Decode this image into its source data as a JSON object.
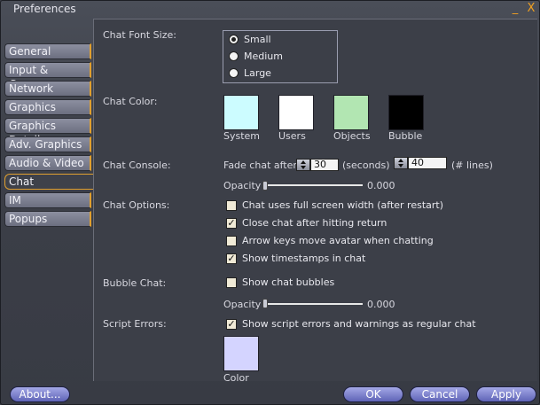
{
  "window": {
    "title": "Preferences",
    "minimize_icon": "minimize-icon",
    "close_icon": "close-icon",
    "minimize_glyph": "_",
    "close_glyph": "X"
  },
  "tabs": [
    {
      "label": "General"
    },
    {
      "label": "Input & Camera"
    },
    {
      "label": "Network"
    },
    {
      "label": "Graphics"
    },
    {
      "label": "Graphics Detail"
    },
    {
      "label": "Adv. Graphics"
    },
    {
      "label": "Audio & Video"
    },
    {
      "label": "Chat"
    },
    {
      "label": "IM"
    },
    {
      "label": "Popups"
    }
  ],
  "selected_tab": "Chat",
  "chat": {
    "font_size_label": "Chat Font Size:",
    "font_sizes": [
      "Small",
      "Medium",
      "Large"
    ],
    "font_size_selected": "Small",
    "color_label": "Chat Color:",
    "colors": [
      {
        "label": "System",
        "color": "#ccfcff"
      },
      {
        "label": "Users",
        "color": "#ffffff"
      },
      {
        "label": "Objects",
        "color": "#b2e6b2"
      },
      {
        "label": "Bubble",
        "color": "#000000"
      }
    ],
    "console_label": "Chat Console:",
    "fade_label": "Fade chat after",
    "fade_value": "30",
    "seconds_label": "(seconds)",
    "lines_value": "40",
    "lines_label": "(# lines)",
    "opacity_label": "Opacity",
    "opacity_value": "0.000",
    "options_label": "Chat Options:",
    "options": [
      {
        "label": "Chat uses full screen width (after restart)",
        "checked": false
      },
      {
        "label": "Close chat after hitting return",
        "checked": true
      },
      {
        "label": "Arrow keys move avatar when chatting",
        "checked": false
      },
      {
        "label": "Show timestamps in chat",
        "checked": true
      }
    ],
    "bubble_label": "Bubble Chat:",
    "bubble_option": {
      "label": "Show chat bubbles",
      "checked": false
    },
    "bubble_opacity_label": "Opacity",
    "bubble_opacity_value": "0.000",
    "script_errors_label": "Script Errors:",
    "script_errors_option": {
      "label": "Show script errors and warnings as regular chat",
      "checked": true
    },
    "script_color_label": "Color",
    "script_color": "#d4d4ff"
  },
  "buttons": {
    "about": "About...",
    "ok": "OK",
    "cancel": "Cancel",
    "apply": "Apply"
  }
}
